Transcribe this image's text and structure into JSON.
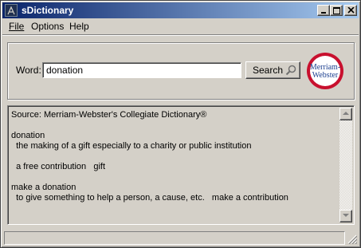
{
  "window": {
    "title": "sDictionary"
  },
  "menu": {
    "file": "File",
    "options": "Options",
    "help": "Help"
  },
  "search": {
    "label": "Word:",
    "value": "donation",
    "button_label": "Search"
  },
  "logo": {
    "line1": "Merriam-",
    "line2": "Webster",
    "brand_color": "#c8102e"
  },
  "result": {
    "lines": [
      "Source: Merriam-Webster's Collegiate Dictionary®",
      "",
      "donation",
      "  the making of a gift especially to a charity or public institution",
      "",
      "  a free contribution   gift",
      "",
      "make a donation",
      "  to give something to help a person, a cause, etc.   make a contribution"
    ]
  },
  "status": {
    "text": ""
  }
}
